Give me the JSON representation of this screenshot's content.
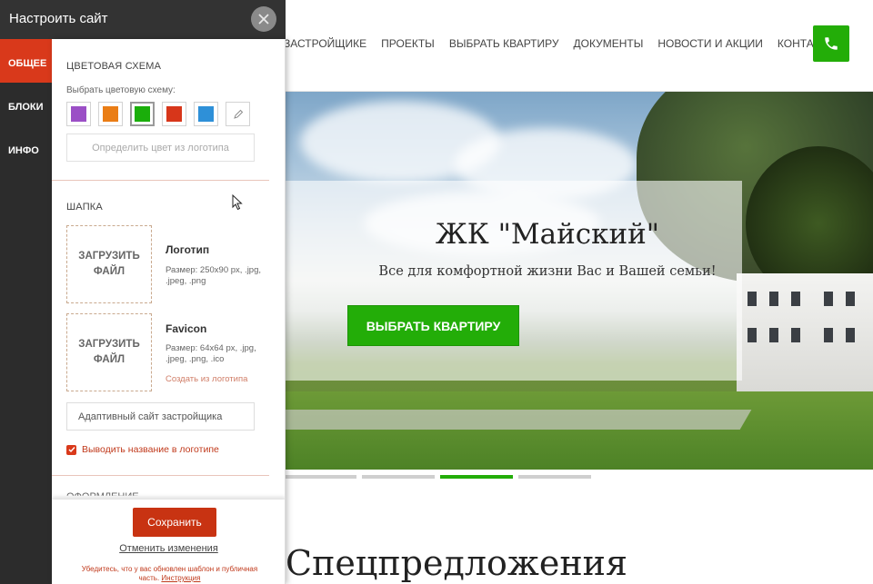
{
  "site": {
    "nav": [
      "ЗАСТРОЙЩИКЕ",
      "ПРОЕКТЫ",
      "ВЫБРАТЬ КВАРТИРУ",
      "ДОКУМЕНТЫ",
      "НОВОСТИ И АКЦИИ",
      "КОНТАКТЫ"
    ],
    "phone_icon": "phone-icon",
    "accent_color": "#23ad08",
    "hero": {
      "title": "ЖК \"Майский\"",
      "subtitle": "Все для комфортной жизни Вас и Вашей семьи!",
      "cta": "ВЫБРАТЬ КВАРТИРУ"
    },
    "slider": {
      "slides": 4,
      "active": 3
    },
    "section_heading": "Спецпредложения"
  },
  "panel": {
    "title": "Настроить сайт",
    "close_icon": "close-icon",
    "tabs": [
      "ОБЩЕЕ",
      "БЛОКИ",
      "ИНФО"
    ],
    "active_tab": "ОБЩЕЕ",
    "tab_color": "#d9391b",
    "color_scheme": {
      "heading": "ЦВЕТОВАЯ СХЕМА",
      "label": "Выбрать цветовую схему:",
      "swatches": [
        "#9b4fc6",
        "#ea7d15",
        "#1aae0a",
        "#d7361a",
        "#2e90d8"
      ],
      "selected": "#1aae0a",
      "custom_icon": "pencil-icon",
      "detect_button": "Определить цвет из логотипа"
    },
    "header_section": {
      "heading": "ШАПКА",
      "logo": {
        "upload_label": "ЗАГРУЗИТЬ ФАЙЛ",
        "name": "Логотип",
        "hint": "Размер: 250x90 px, .jpg, .jpeg, .png"
      },
      "favicon": {
        "upload_label": "ЗАГРУЗИТЬ ФАЙЛ",
        "name": "Favicon",
        "hint": "Размер: 64x64 px, .jpg, .jpeg, .png, .ico",
        "link": "Создать из логотипа"
      },
      "site_name_value": "Адаптивный сайт застройщика",
      "show_name_checkbox": {
        "label": "Выводить название в логотипе",
        "checked": true
      },
      "next_heading_partial": "ОФОРМЛЕНИЕ"
    },
    "footer": {
      "save": "Сохранить",
      "cancel": "Отменить изменения",
      "note": "Убедитесь, что у вас обновлен шаблон и публичная часть.",
      "note_link": "Инструкция"
    }
  }
}
